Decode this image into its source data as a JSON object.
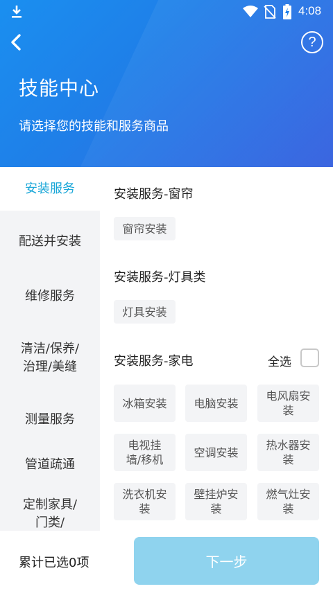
{
  "status_bar": {
    "time": "4:08",
    "icons": [
      "download-icon",
      "wifi-icon",
      "no-sim-icon",
      "battery-charging-icon"
    ]
  },
  "header": {
    "title": "技能中心",
    "subtitle": "请选择您的技能和服务商品",
    "help_label": "?"
  },
  "sidebar": {
    "items": [
      {
        "label": "安装服务",
        "active": true
      },
      {
        "label": "配送并安装"
      },
      {
        "label": "维修服务"
      },
      {
        "label": "清洁/保养/治理/美缝"
      },
      {
        "label": "测量服务"
      },
      {
        "label": "管道疏通"
      },
      {
        "label": "定制家具/门类/"
      }
    ]
  },
  "sections": [
    {
      "title": "安装服务-窗帘",
      "tags": [
        "窗帘安装"
      ]
    },
    {
      "title": "安装服务-灯具类",
      "tags": [
        "灯具安装"
      ]
    },
    {
      "title": "安装服务-家电",
      "select_all_label": "全选",
      "tags": [
        "冰箱安装",
        "电脑安装",
        "电风扇安装",
        "电视挂墙/移机",
        "空调安装",
        "热水器安装",
        "洗衣机安装",
        "壁挂炉安装",
        "燃气灶安装"
      ]
    }
  ],
  "footer": {
    "selected_count": "累计已选0项",
    "next_label": "下一步"
  },
  "colors": {
    "accent": "#1ba7d8",
    "header_blue": "#1f7fe8",
    "next_disabled": "#8fd3ee"
  }
}
